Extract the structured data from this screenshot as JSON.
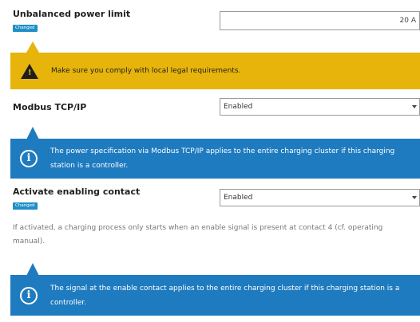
{
  "unbalanced": {
    "label": "Unbalanced power limit",
    "badge": "Changed",
    "value": "20 A"
  },
  "legal_warning": {
    "icon": "warning-triangle-icon",
    "exclamation": "!",
    "text": "Make sure you comply with local legal requirements.",
    "color": "#e6b40b"
  },
  "modbus": {
    "label": "Modbus TCP/IP",
    "selected": "Enabled"
  },
  "modbus_info": {
    "icon": "info-circle-icon",
    "icon_glyph": "i",
    "text": "The power specification via Modbus TCP/IP applies to the entire charging cluster if this charging station is a controller.",
    "color": "#1f7bbf"
  },
  "enabling": {
    "label": "Activate enabling contact",
    "badge": "Changed",
    "selected": "Enabled",
    "help": "If activated, a charging process only starts when an enable signal is present at contact 4 (cf. operating manual)."
  },
  "enabling_info": {
    "icon": "info-circle-icon",
    "icon_glyph": "i",
    "text": "The signal at the enable contact applies to the entire charging cluster if this charging station is a controller."
  }
}
